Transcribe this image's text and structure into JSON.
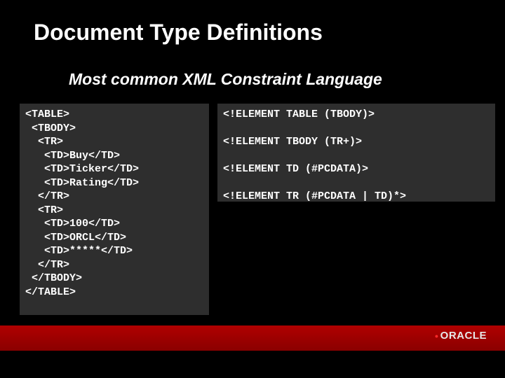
{
  "title": "Document Type Definitions",
  "subtitle": "Most common XML Constraint Language",
  "code_left": "<TABLE>\n <TBODY>\n  <TR>\n   <TD>Buy</TD>\n   <TD>Ticker</TD>\n   <TD>Rating</TD>\n  </TR>\n  <TR>\n   <TD>100</TD>\n   <TD>ORCL</TD>\n   <TD>*****</TD>\n  </TR>\n </TBODY>\n</TABLE>",
  "code_right": "<!ELEMENT TABLE (TBODY)>\n\n<!ELEMENT TBODY (TR+)>\n\n<!ELEMENT TD (#PCDATA)>\n\n<!ELEMENT TR (#PCDATA | TD)*>",
  "logo_text": "ORACLE"
}
